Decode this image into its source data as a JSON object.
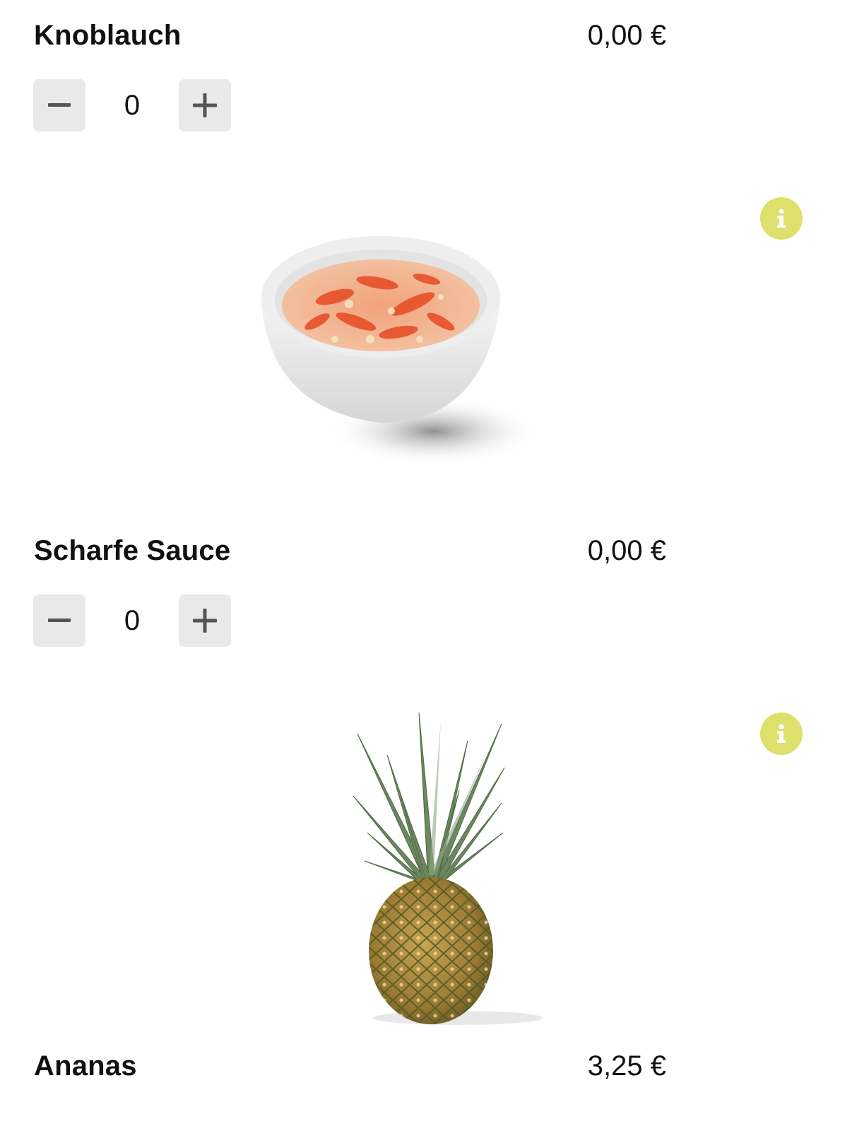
{
  "items": [
    {
      "name": "Knoblauch",
      "price": "0,00 €",
      "quantity": "0"
    },
    {
      "name": "Scharfe Sauce",
      "price": "0,00 €",
      "quantity": "0",
      "image_icon": "sauce-bowl-image"
    },
    {
      "name": "Ananas",
      "price": "3,25 €",
      "image_icon": "pineapple-image"
    }
  ],
  "colors": {
    "info_badge": "#dde06a",
    "stepper_bg": "#e9e9e9",
    "stepper_icon": "#555555"
  }
}
